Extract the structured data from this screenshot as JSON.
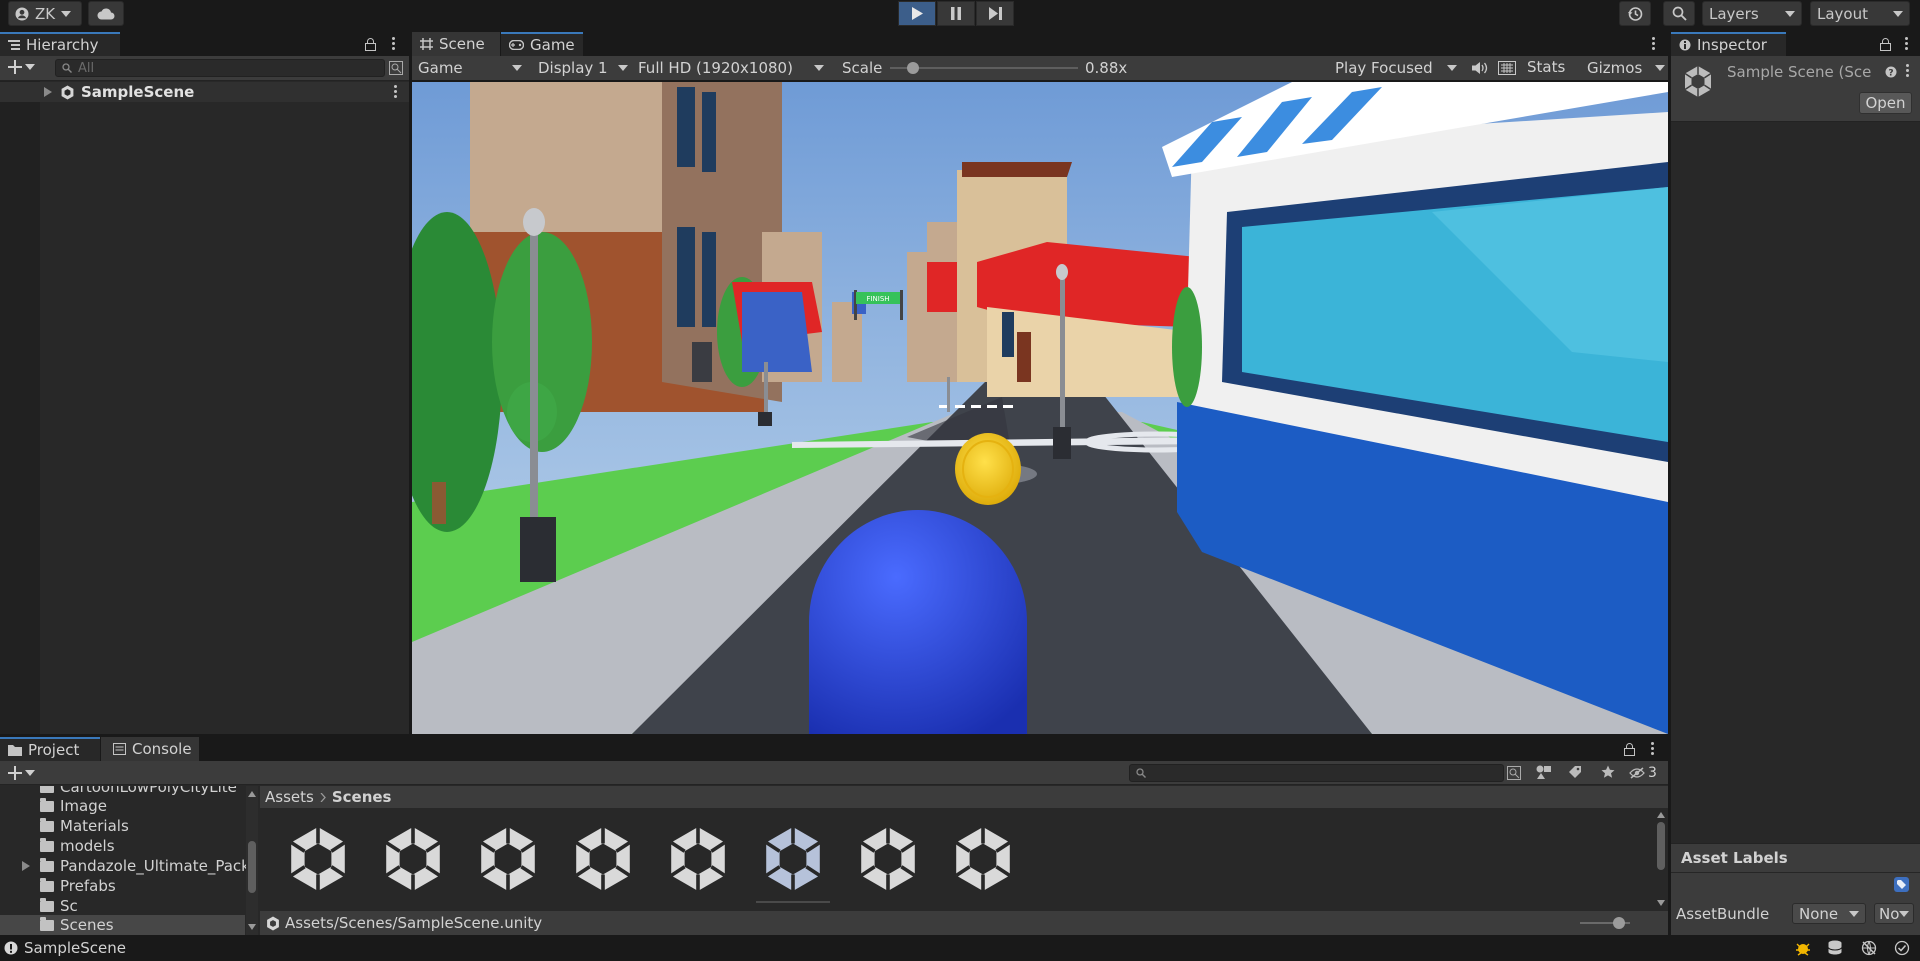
{
  "toolbar": {
    "account": "ZK",
    "layers": "Layers",
    "layout": "Layout"
  },
  "hierarchy": {
    "tab": "Hierarchy",
    "search_placeholder": "All",
    "scene": "SampleScene"
  },
  "scene_tabs": {
    "scene": "Scene",
    "game": "Game"
  },
  "game_bar": {
    "mode": "Game",
    "display": "Display 1",
    "resolution": "Full HD (1920x1080)",
    "scale_label": "Scale",
    "scale_value": "0.88x",
    "scale_fraction": 0.12,
    "play_focused": "Play Focused",
    "stats": "Stats",
    "gizmos": "Gizmos"
  },
  "game_view": {
    "banner": "FINISH"
  },
  "inspector": {
    "tab": "Inspector",
    "title": "Sample Scene (Sce",
    "open": "Open",
    "asset_labels": "Asset Labels",
    "asset_bundle": "AssetBundle",
    "bundle_value": "None",
    "variant_value": "No"
  },
  "project": {
    "tab_project": "Project",
    "tab_console": "Console",
    "hidden_count": "3",
    "tree": [
      "CartoonLowPolyCityLite",
      "Image",
      "Materials",
      "models",
      "Pandazole_Ultimate_Pack",
      "Prefabs",
      "Sc",
      "Scenes"
    ],
    "breadcrumb": [
      "Assets",
      "Scenes"
    ],
    "asset_count": 8,
    "selected_index": 5,
    "path": "Assets/Scenes/SampleScene.unity"
  },
  "status": {
    "text": "SampleScene"
  },
  "colors": {
    "accent": "#3a79bb",
    "sky_top": "#6f9bd6",
    "sky_bottom": "#c7dcee",
    "grass": "#5ccd4f",
    "road": "#3f434b",
    "player": "#2244dd",
    "coin": "#f2c31b",
    "roof": "#e02626"
  }
}
